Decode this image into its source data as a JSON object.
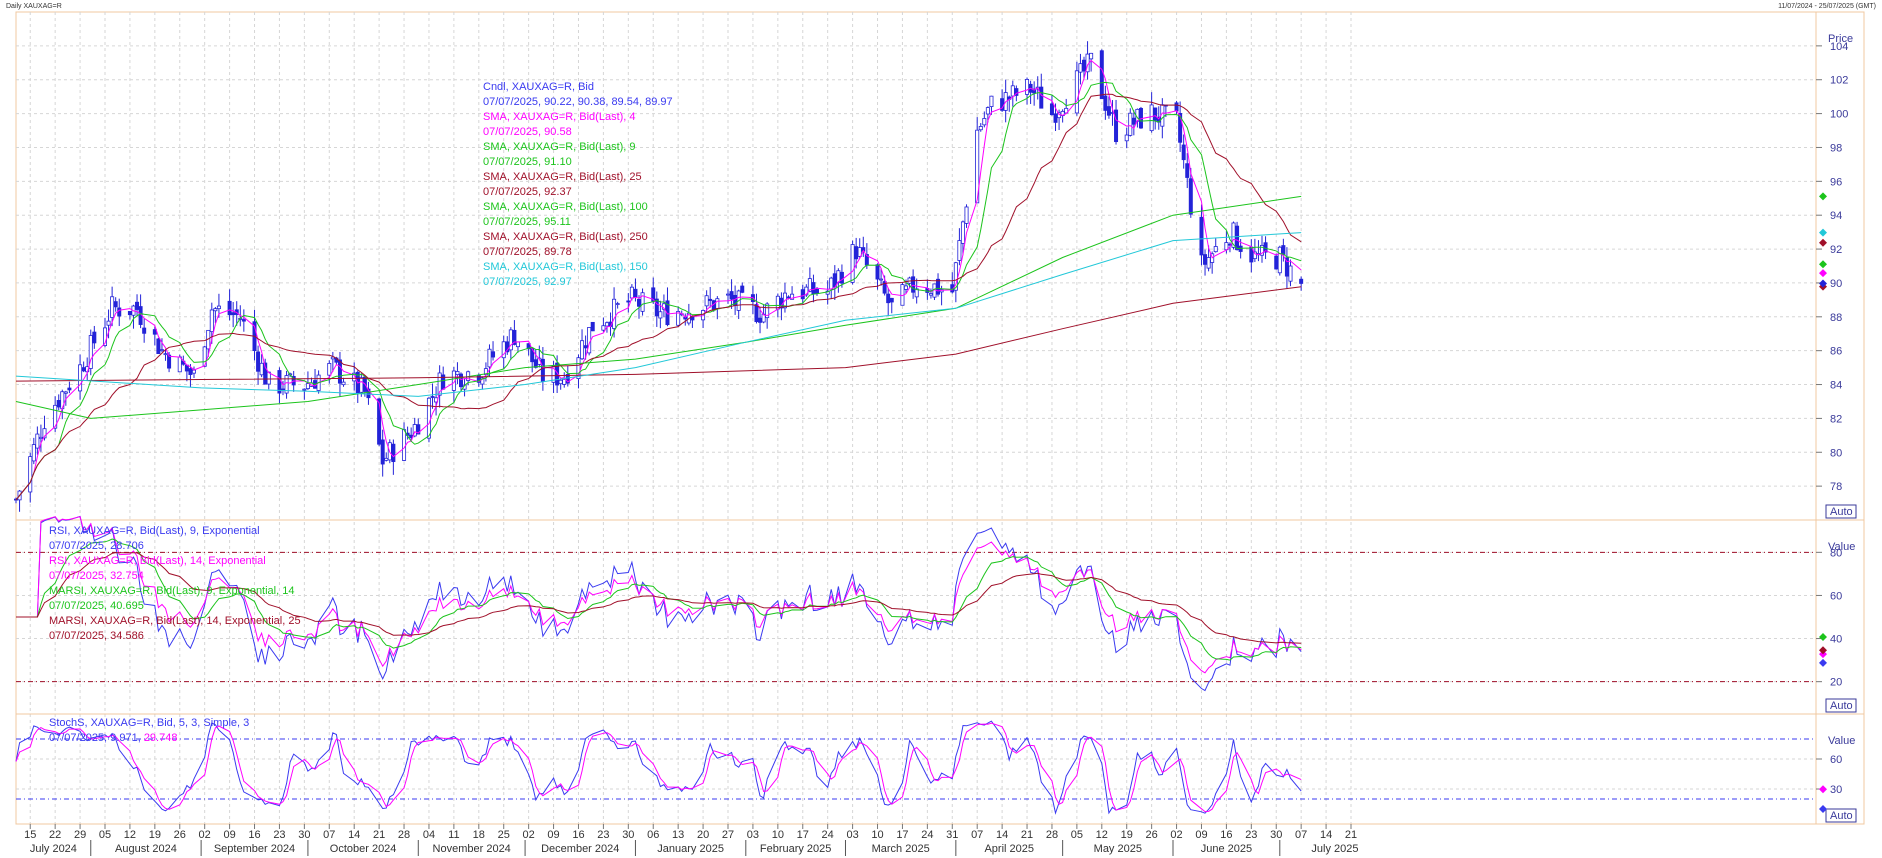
{
  "header": {
    "left": "Daily XAUXAG=R",
    "right": "11/07/2024 - 25/07/2025 (GMT)"
  },
  "legends": {
    "price": [
      {
        "text": "Cndl, XAUXAG=R, Bid",
        "color": "#3a3af0"
      },
      {
        "text": "07/07/2025, 90.22, 90.38, 89.54, 89.97",
        "color": "#3a3af0"
      },
      {
        "text": "SMA, XAUXAG=R, Bid(Last),  4",
        "color": "#ff00ff"
      },
      {
        "text": "07/07/2025, 90.58",
        "color": "#ff00ff"
      },
      {
        "text": "SMA, XAUXAG=R, Bid(Last),  9",
        "color": "#1cc41c"
      },
      {
        "text": "07/07/2025, 91.10",
        "color": "#1cc41c"
      },
      {
        "text": "SMA, XAUXAG=R, Bid(Last),  25",
        "color": "#a0102a"
      },
      {
        "text": "07/07/2025, 92.37",
        "color": "#a0102a"
      },
      {
        "text": "SMA, XAUXAG=R, Bid(Last),  100",
        "color": "#1cc41c"
      },
      {
        "text": "07/07/2025, 95.11",
        "color": "#1cc41c"
      },
      {
        "text": "SMA, XAUXAG=R, Bid(Last),  250",
        "color": "#a0102a"
      },
      {
        "text": "07/07/2025, 89.78",
        "color": "#a0102a"
      },
      {
        "text": "SMA, XAUXAG=R, Bid(Last),  150",
        "color": "#22c8d8"
      },
      {
        "text": "07/07/2025, 92.97",
        "color": "#22c8d8"
      }
    ],
    "rsi": [
      {
        "text": "RSI, XAUXAG=R, Bid(Last),  9, Exponential",
        "color": "#3a3af0"
      },
      {
        "text": "07/07/2025, 28.706",
        "color": "#3a3af0"
      },
      {
        "text": "RSI, XAUXAG=R, Bid(Last),  14, Exponential",
        "color": "#ff00ff"
      },
      {
        "text": "07/07/2025, 32.754",
        "color": "#ff00ff"
      },
      {
        "text": "MARSI, XAUXAG=R, Bid(Last),  9, Exponential, 14",
        "color": "#1cc41c"
      },
      {
        "text": "07/07/2025, 40.695",
        "color": "#1cc41c"
      },
      {
        "text": "MARSI, XAUXAG=R, Bid(Last),  14, Exponential, 25",
        "color": "#a0102a"
      },
      {
        "text": "07/07/2025, 34.586",
        "color": "#a0102a"
      }
    ],
    "stoch": [
      {
        "text": "StochS, XAUXAG=R, Bid,  5, 3, Simple, 3",
        "color": "#3a3af0"
      },
      {
        "text": "07/07/2025, 9.971, ",
        "color": "#3a3af0",
        "extra": "29.748",
        "extra_color": "#ff00ff"
      }
    ]
  },
  "chart_data": [
    {
      "type": "candlestick",
      "title": "Cndl, XAUXAG=R, Bid",
      "ylabel": "Price",
      "yticks": [
        78,
        80,
        82,
        84,
        86,
        88,
        90,
        92,
        94,
        96,
        98,
        100,
        102,
        104
      ],
      "ylim": [
        76,
        106
      ],
      "scale_button": "Auto",
      "last_candle": {
        "date": "07/07/2025",
        "open": 90.22,
        "high": 90.38,
        "low": 89.54,
        "close": 89.97
      },
      "close_path": {
        "x": [
          "2024-07-11",
          "2024-07-19",
          "2024-07-29",
          "2024-08-07",
          "2024-08-14",
          "2024-08-21",
          "2024-08-30",
          "2024-09-04",
          "2024-09-12",
          "2024-09-20",
          "2024-09-30",
          "2024-10-08",
          "2024-10-17",
          "2024-10-22",
          "2024-10-31",
          "2024-11-08",
          "2024-11-18",
          "2024-11-28",
          "2024-12-06",
          "2024-12-12",
          "2024-12-20",
          "2024-12-31",
          "2025-01-08",
          "2025-01-17",
          "2025-01-27",
          "2025-02-06",
          "2025-02-13",
          "2025-02-24",
          "2025-03-04",
          "2025-03-14",
          "2025-03-21",
          "2025-03-31",
          "2025-04-07",
          "2025-04-11",
          "2025-04-22",
          "2025-04-28",
          "2025-05-09",
          "2025-05-16",
          "2025-05-26",
          "2025-06-02",
          "2025-06-09",
          "2025-06-17",
          "2025-06-24",
          "2025-07-01",
          "2025-07-07"
        ],
        "close": [
          77.2,
          82.0,
          85.0,
          88.5,
          88.5,
          86.0,
          84.5,
          88.5,
          88.0,
          84.0,
          84.0,
          85.0,
          83.5,
          79.5,
          81.5,
          84.5,
          84.8,
          87.0,
          84.5,
          84.5,
          87.5,
          89.0,
          88.2,
          88.5,
          89.0,
          88.2,
          89.5,
          89.5,
          92.0,
          88.5,
          90.0,
          89.5,
          99.0,
          100.5,
          101.5,
          100.0,
          103.0,
          99.0,
          100.0,
          99.5,
          91.0,
          93.0,
          91.5,
          91.5,
          89.97
        ]
      },
      "series": [
        {
          "name": "SMA 4",
          "color": "#ff00ff",
          "last": 90.58
        },
        {
          "name": "SMA 9",
          "color": "#1cc41c",
          "last": 91.1
        },
        {
          "name": "SMA 25",
          "color": "#a0102a",
          "last": 92.37
        },
        {
          "name": "SMA 100",
          "color": "#1cc41c",
          "last": 95.11,
          "x": [
            "2024-07-11",
            "2024-08-01",
            "2024-09-01",
            "2024-10-01",
            "2024-11-01",
            "2024-12-01",
            "2025-01-01",
            "2025-02-01",
            "2025-03-01",
            "2025-04-01",
            "2025-05-01",
            "2025-06-01",
            "2025-07-07"
          ],
          "y": [
            83.0,
            82.0,
            82.5,
            83.0,
            84.0,
            85.0,
            85.5,
            86.5,
            87.5,
            88.5,
            91.5,
            94.0,
            95.11
          ]
        },
        {
          "name": "SMA 250",
          "color": "#a0102a",
          "last": 89.78,
          "x": [
            "2024-07-11",
            "2024-09-01",
            "2024-11-01",
            "2025-01-01",
            "2025-03-01",
            "2025-04-01",
            "2025-05-01",
            "2025-06-01",
            "2025-07-07"
          ],
          "y": [
            84.2,
            84.3,
            84.4,
            84.6,
            85.0,
            85.8,
            87.3,
            88.8,
            89.78
          ]
        },
        {
          "name": "SMA 150",
          "color": "#22c8d8",
          "last": 92.97,
          "x": [
            "2024-07-11",
            "2024-09-01",
            "2024-10-01",
            "2024-11-01",
            "2024-12-01",
            "2025-01-01",
            "2025-02-01",
            "2025-03-01",
            "2025-04-01",
            "2025-05-01",
            "2025-06-01",
            "2025-07-07"
          ],
          "y": [
            84.5,
            83.8,
            83.6,
            83.3,
            84.0,
            85.0,
            86.5,
            87.8,
            88.5,
            90.5,
            92.5,
            92.97
          ]
        }
      ]
    },
    {
      "type": "line",
      "title": "RSI",
      "ylabel": "Value",
      "yticks": [
        20,
        40,
        60,
        80
      ],
      "ylim": [
        5,
        95
      ],
      "bands": [
        20,
        80
      ],
      "scale_button": "Auto",
      "series": [
        {
          "name": "RSI 9",
          "color": "#3a3af0",
          "last": 28.706
        },
        {
          "name": "RSI 14",
          "color": "#ff00ff",
          "last": 32.754
        },
        {
          "name": "MARSI 9",
          "color": "#1cc41c",
          "last": 40.695
        },
        {
          "name": "MARSI 14",
          "color": "#a0102a",
          "last": 34.586
        }
      ]
    },
    {
      "type": "line",
      "title": "StochS",
      "ylabel": "Value",
      "yticks": [
        30,
        60
      ],
      "ylim": [
        -5,
        105
      ],
      "bands": [
        20,
        80
      ],
      "scale_button": "Auto",
      "series": [
        {
          "name": "StochS %K",
          "color": "#3a3af0",
          "last": 9.971
        },
        {
          "name": "StochS %D",
          "color": "#ff00ff",
          "last": 29.748
        }
      ]
    }
  ],
  "x_axis": {
    "days": [
      "15",
      "22",
      "29",
      "05",
      "12",
      "19",
      "26",
      "02",
      "09",
      "16",
      "23",
      "30",
      "07",
      "14",
      "21",
      "28",
      "04",
      "11",
      "18",
      "25",
      "02",
      "09",
      "16",
      "23",
      "30",
      "06",
      "13",
      "20",
      "27",
      "03",
      "10",
      "17",
      "24",
      "03",
      "10",
      "17",
      "24",
      "31",
      "07",
      "14",
      "21",
      "28",
      "05",
      "12",
      "19",
      "26",
      "02",
      "09",
      "16",
      "23",
      "30",
      "07",
      "14",
      "21"
    ],
    "months": [
      "July 2024",
      "August 2024",
      "September 2024",
      "October 2024",
      "November 2024",
      "December 2024",
      "January 2025",
      "February 2025",
      "March 2025",
      "April 2025",
      "May 2025",
      "June 2025",
      "July 2025"
    ]
  }
}
